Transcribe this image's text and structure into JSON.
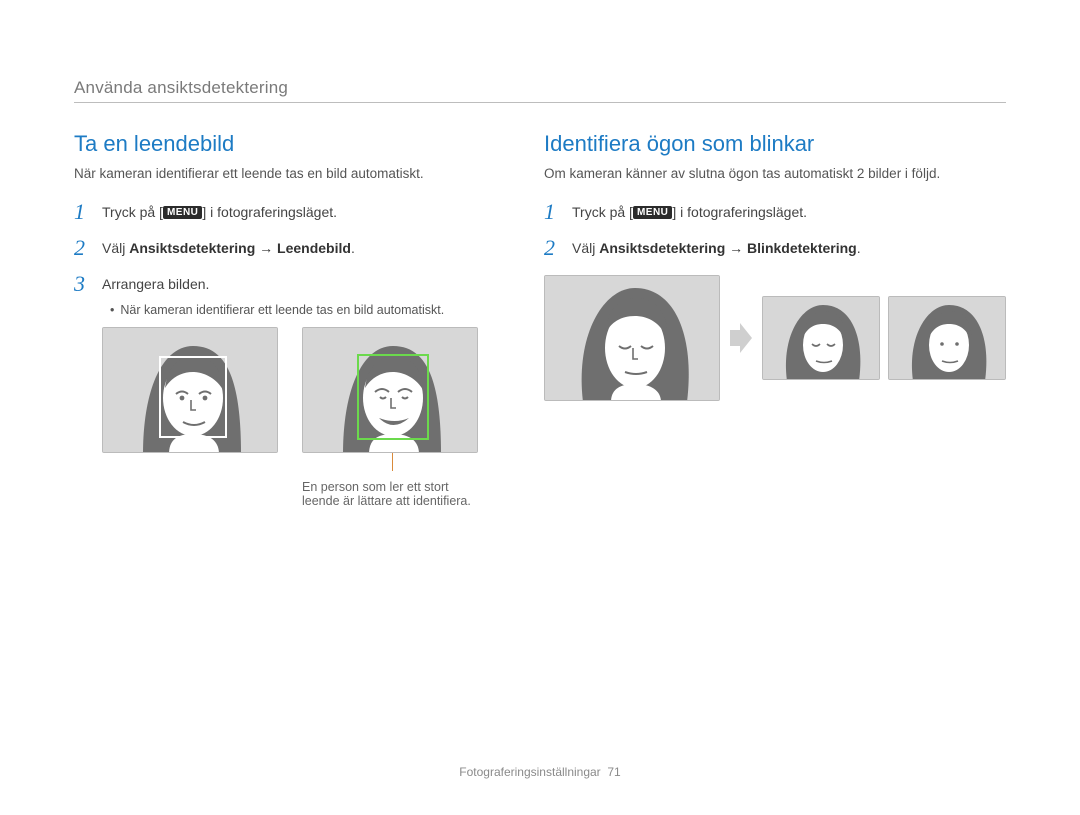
{
  "header": {
    "title": "Använda ansiktsdetektering"
  },
  "left": {
    "title": "Ta en leendebild",
    "intro": "När kameran identifierar ett leende tas en bild automatiskt.",
    "steps": [
      {
        "num": "1",
        "pre": "Tryck på [",
        "menu": "MENU",
        "post": "] i fotograferingsläget."
      },
      {
        "num": "2",
        "pre": "Välj ",
        "bold": "Ansiktsdetektering → Leendebild",
        "post": "."
      },
      {
        "num": "3",
        "pre": "Arrangera bilden."
      }
    ],
    "bullet": "När kameran identifierar ett leende tas en bild automatiskt.",
    "caption": "En person som ler ett stort leende är lättare att identifiera."
  },
  "right": {
    "title": "Identifiera ögon som blinkar",
    "intro": "Om kameran känner av slutna ögon tas automatiskt 2 bilder i följd.",
    "steps": [
      {
        "num": "1",
        "pre": "Tryck på [",
        "menu": "MENU",
        "post": "] i fotograferingsläget."
      },
      {
        "num": "2",
        "pre": "Välj ",
        "bold": "Ansiktsdetektering → Blinkdetektering",
        "post": "."
      }
    ]
  },
  "footer": {
    "section": "Fotograferingsinställningar",
    "page": "71"
  },
  "icons": {
    "menu": "MENU"
  }
}
